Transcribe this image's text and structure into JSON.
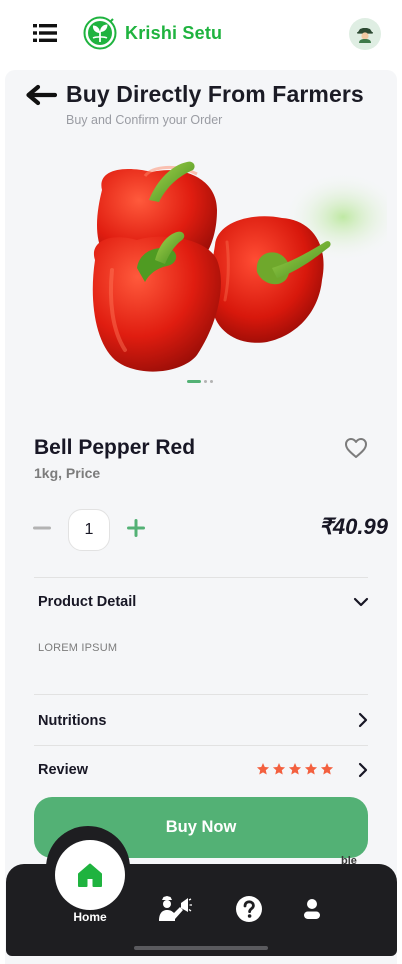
{
  "app": {
    "brand_name": "Krishi Setu",
    "brand_color": "#1fb33f"
  },
  "header": {
    "title": "Buy Directly From Farmers",
    "subtitle": "Buy and Confirm your Order"
  },
  "icons": {
    "menu": "menu-icon",
    "logo": "krishi-setu-logo",
    "avatar": "farmer-avatar-icon",
    "back": "back-arrow-icon",
    "favorite": "heart-icon",
    "minus": "minus-icon",
    "plus": "plus-icon",
    "expand": "chevron-down-icon",
    "forward": "chevron-right-icon",
    "star": "star-icon",
    "home": "home-icon",
    "announce": "farmer-announce-icon",
    "help": "help-icon",
    "profile": "profile-icon"
  },
  "carousel": {
    "image": "red bell peppers",
    "slide_count": 3,
    "active_slide": 1
  },
  "product": {
    "name": "Bell Pepper Red",
    "unit": "1kg, Price",
    "quantity": "1",
    "price": "₹40.99",
    "detail_label": "Product Detail",
    "detail_text": "LOREM IPSUM",
    "nutrition_label": "Nutritions",
    "review_label": "Review",
    "rating": 5,
    "rating_max": 5
  },
  "actions": {
    "buy_label": "Buy Now",
    "peek_text": "ble"
  },
  "bottom_nav": {
    "home_label": "Home"
  },
  "colors": {
    "accent": "#53b175",
    "star": "#f3603f",
    "nav_bg": "#1e1e21",
    "home_icon": "#1fb33f"
  }
}
